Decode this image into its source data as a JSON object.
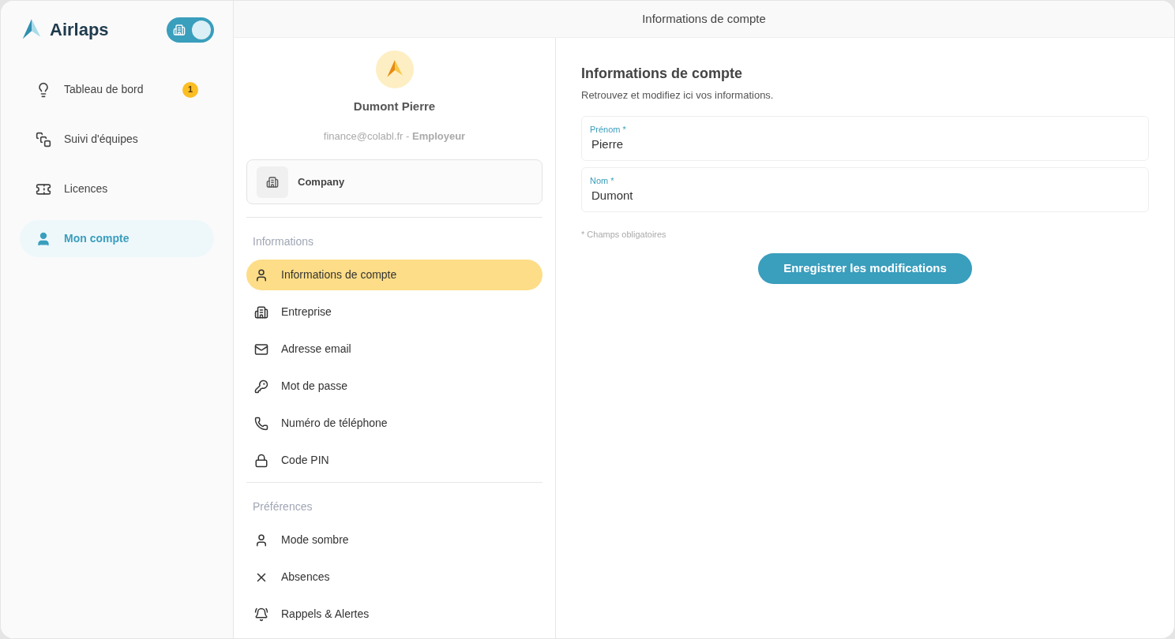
{
  "brand": {
    "name": "Airlaps"
  },
  "mode_toggle": {
    "on": true
  },
  "sidebar": {
    "items": [
      {
        "label": "Tableau de bord",
        "selected": false,
        "badge": "1"
      },
      {
        "label": "Suivi d'équipes",
        "selected": false
      },
      {
        "label": "Licences",
        "selected": false
      },
      {
        "label": "Mon compte",
        "selected": true
      }
    ]
  },
  "header": {
    "title": "Informations de compte"
  },
  "profile": {
    "name": "Dumont Pierre",
    "email": "finance@colabl.fr",
    "separator": " - ",
    "role": "Employeur",
    "company": "Company"
  },
  "menu_sections": [
    {
      "title": "Informations",
      "items": [
        {
          "label": "Informations de compte",
          "selected": true
        },
        {
          "label": "Entreprise",
          "selected": false
        },
        {
          "label": "Adresse email",
          "selected": false
        },
        {
          "label": "Mot de passe",
          "selected": false
        },
        {
          "label": "Numéro de téléphone",
          "selected": false
        },
        {
          "label": "Code PIN",
          "selected": false
        }
      ]
    },
    {
      "title": "Préférences",
      "items": [
        {
          "label": "Mode sombre",
          "selected": false
        },
        {
          "label": "Absences",
          "selected": false
        },
        {
          "label": "Rappels & Alertes",
          "selected": false
        }
      ]
    }
  ],
  "form": {
    "title": "Informations de compte",
    "subtitle": "Retrouvez et modifiez ici vos informations.",
    "fields": [
      {
        "label": "Prénom *",
        "value": "Pierre"
      },
      {
        "label": "Nom *",
        "value": "Dumont"
      }
    ],
    "note": "* Champs obligatoires",
    "submit": "Enregistrer les modifications"
  }
}
